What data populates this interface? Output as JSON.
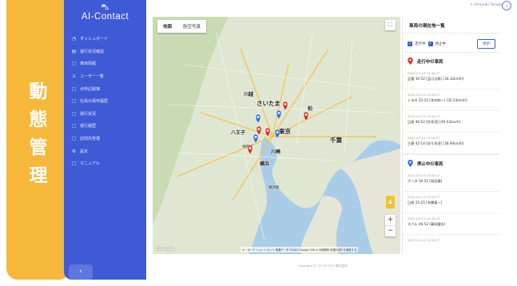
{
  "badge": {
    "chars": [
      "動",
      "態",
      "管",
      "理"
    ]
  },
  "app": {
    "car_icon": "car-icon",
    "name": "AI-Contact"
  },
  "nav": [
    {
      "icon": "◔",
      "label": "ダッシュボード"
    },
    {
      "icon": "▤",
      "label": "運行状況確認"
    },
    {
      "icon": "▢",
      "label": "車両情報"
    },
    {
      "icon": "♙",
      "label": "ユーザー一覧"
    },
    {
      "icon": "▢",
      "label": "点呼記録簿"
    },
    {
      "icon": "▢",
      "label": "社員の保存履歴"
    },
    {
      "icon": "▢",
      "label": "運行状況"
    },
    {
      "icon": "▢",
      "label": "運行履歴"
    },
    {
      "icon": "▢",
      "label": "訪問先管理"
    },
    {
      "icon": "⚙",
      "label": "設定"
    },
    {
      "icon": "▢",
      "label": "マニュアル"
    }
  ],
  "user": {
    "name": "Hiroyuki Tanaka"
  },
  "map": {
    "tab_map": "地図",
    "tab_satellite": "航空写真",
    "cities": [
      "さいたま",
      "東京",
      "千葉",
      "川崎",
      "横浜",
      "八王子",
      "川越",
      "柏",
      "相模原",
      "横須賀"
    ],
    "footer": "キーボード ショートカット  地図データ ©2022 Google  500 m  利用規約  地図の誤りを報告する",
    "google": "Google",
    "marker_counts": {
      "running": 5,
      "stopped": 4
    }
  },
  "panel": {
    "title": "車両の現在地一覧",
    "filter_running": "走行中",
    "filter_stopped": "停止中",
    "refresh": "更新",
    "running_header": "走行中の車両",
    "stopped_header": "停止中の車両",
    "running": [
      {
        "ts": "2022-03-14 15:30:27",
        "vehicle": "品番 30-52 [品川太郎] [34.32km/h]"
      },
      {
        "ts": "2022-03-14 15:30:27",
        "vehicle": "トヨタ 25-25 [木村純一] [35.53km/h]"
      },
      {
        "ts": "2022-03-14 15:30:27",
        "vehicle": "日産 46-52 [鈴木茂] [49.52km/h]"
      },
      {
        "ts": "2022-03-14 15:30:27",
        "vehicle": "三菱 42-14 [佐々木茂] [28.94km/h]"
      }
    ],
    "stopped": [
      {
        "ts": "2022-03-14 15:30:27",
        "vehicle": "ホンダ 30-52 [岡田健]"
      },
      {
        "ts": "2022-03-14 15:30:27",
        "vehicle": "日産 25-25 [木橋真一]"
      },
      {
        "ts": "2022-03-14 15:30:27",
        "vehicle": "スバル 46-52 [藤岡健夫]"
      },
      {
        "ts": "2022-03-14 15:30:27",
        "vehicle": ""
      }
    ]
  },
  "footer": {
    "copyright": "Copyright © コンテクスト株式会社"
  },
  "colors": {
    "sidebar": "#3e5ad4",
    "badge": "#f5b83a",
    "running_marker": "#d9322b",
    "stopped_marker": "#3e6fd4"
  }
}
